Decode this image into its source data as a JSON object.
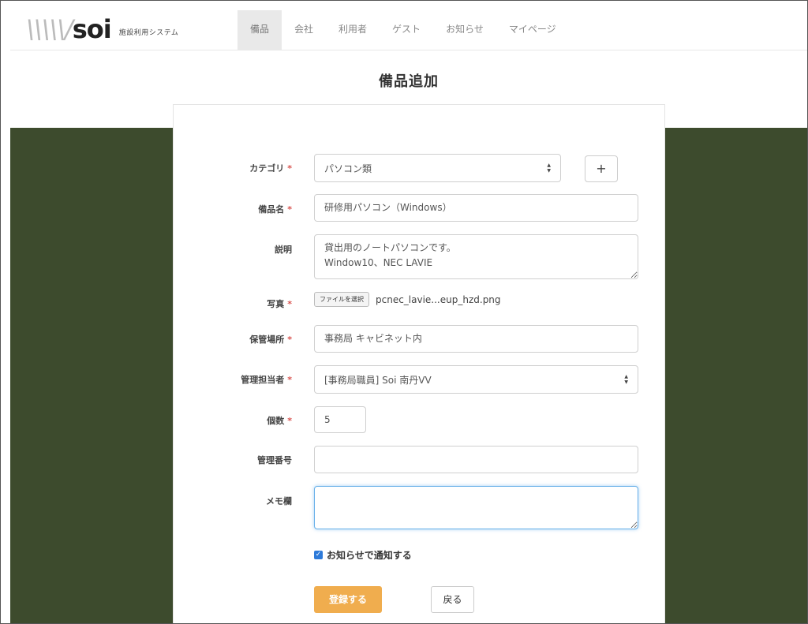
{
  "logo": {
    "mark": "soi",
    "tagline": "施設利用システム"
  },
  "nav": [
    {
      "label": "備品",
      "active": true
    },
    {
      "label": "会社",
      "active": false
    },
    {
      "label": "利用者",
      "active": false
    },
    {
      "label": "ゲスト",
      "active": false
    },
    {
      "label": "お知らせ",
      "active": false
    },
    {
      "label": "マイページ",
      "active": false
    }
  ],
  "page": {
    "title": "備品追加"
  },
  "form": {
    "category": {
      "label": "カテゴリ",
      "value": "パソコン類",
      "add_button": "+"
    },
    "name": {
      "label": "備品名",
      "value": "研修用パソコン（Windows）"
    },
    "description": {
      "label": "説明",
      "value": "貸出用のノートパソコンです。\nWindow10、NEC LAVIE"
    },
    "photo": {
      "label": "写真",
      "button": "ファイルを選択",
      "filename": "pcnec_lavie...eup_hzd.png"
    },
    "location": {
      "label": "保管場所",
      "value": "事務局 キャビネット内"
    },
    "manager": {
      "label": "管理担当者",
      "value": "[事務局職員] Soi 南丹VV"
    },
    "quantity": {
      "label": "個数",
      "value": "5"
    },
    "management_number": {
      "label": "管理番号",
      "value": ""
    },
    "memo": {
      "label": "メモ欄",
      "value": ""
    },
    "notify": {
      "label": "お知らせで通知する",
      "checked": true
    },
    "submit_label": "登録する",
    "back_label": "戻る"
  },
  "required_mark": "*",
  "colors": {
    "accent": "#f0ad4e",
    "background_band": "#3d4b2d",
    "checkbox": "#2d7ad9",
    "required": "#d9534f"
  }
}
